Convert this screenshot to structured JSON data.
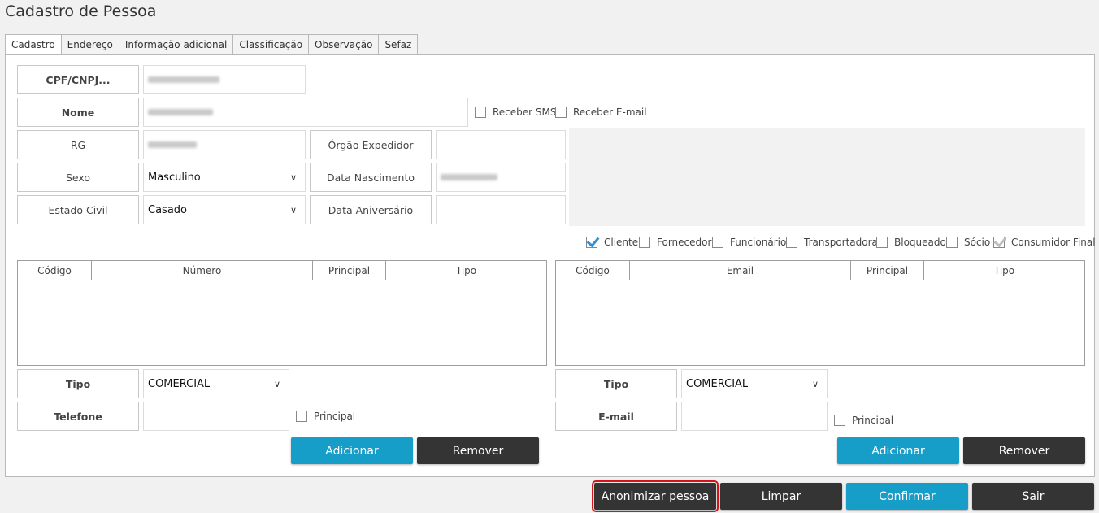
{
  "window": {
    "title": "Cadastro de Pessoa"
  },
  "tabs": [
    {
      "label": "Cadastro"
    },
    {
      "label": "Endereço"
    },
    {
      "label": "Informação adicional"
    },
    {
      "label": "Classificação"
    },
    {
      "label": "Observação"
    },
    {
      "label": "Sefaz"
    }
  ],
  "form": {
    "cpf_label": "CPF/CNPJ...",
    "nome_label": "Nome",
    "rg_label": "RG",
    "orgao_label": "Órgão Expedidor",
    "sexo_label": "Sexo",
    "sexo_value": "Masculino",
    "data_nasc_label": "Data Nascimento",
    "estado_civil_label": "Estado Civil",
    "estado_civil_value": "Casado",
    "data_aniv_label": "Data Aniversário",
    "receber_sms": "Receber SMS",
    "receber_email": "Receber E-mail"
  },
  "roles": [
    {
      "label": "Cliente",
      "checked": true
    },
    {
      "label": "Fornecedor",
      "checked": false
    },
    {
      "label": "Funcionário",
      "checked": false
    },
    {
      "label": "Transportadora",
      "checked": false
    },
    {
      "label": "Bloqueado",
      "checked": false
    },
    {
      "label": "Sócio",
      "checked": false
    },
    {
      "label": "Consumidor Final",
      "checked": true
    }
  ],
  "phones": {
    "columns": [
      "Código",
      "Número",
      "Principal",
      "Tipo"
    ],
    "tipo_label": "Tipo",
    "tipo_value": "COMERCIAL",
    "telefone_label": "Telefone",
    "principal_label": "Principal",
    "add_label": "Adicionar",
    "remove_label": "Remover"
  },
  "emails": {
    "columns": [
      "Código",
      "Email",
      "Principal",
      "Tipo"
    ],
    "tipo_label": "Tipo",
    "tipo_value": "COMERCIAL",
    "email_label": "E-mail",
    "principal_label": "Principal",
    "add_label": "Adicionar",
    "remove_label": "Remover"
  },
  "footer": {
    "anonimizar": "Anonimizar pessoa",
    "limpar": "Limpar",
    "confirmar": "Confirmar",
    "sair": "Sair"
  },
  "colors": {
    "accent_blue": "#169ec8",
    "dark_button": "#343434",
    "highlight_red": "#d4151b"
  }
}
